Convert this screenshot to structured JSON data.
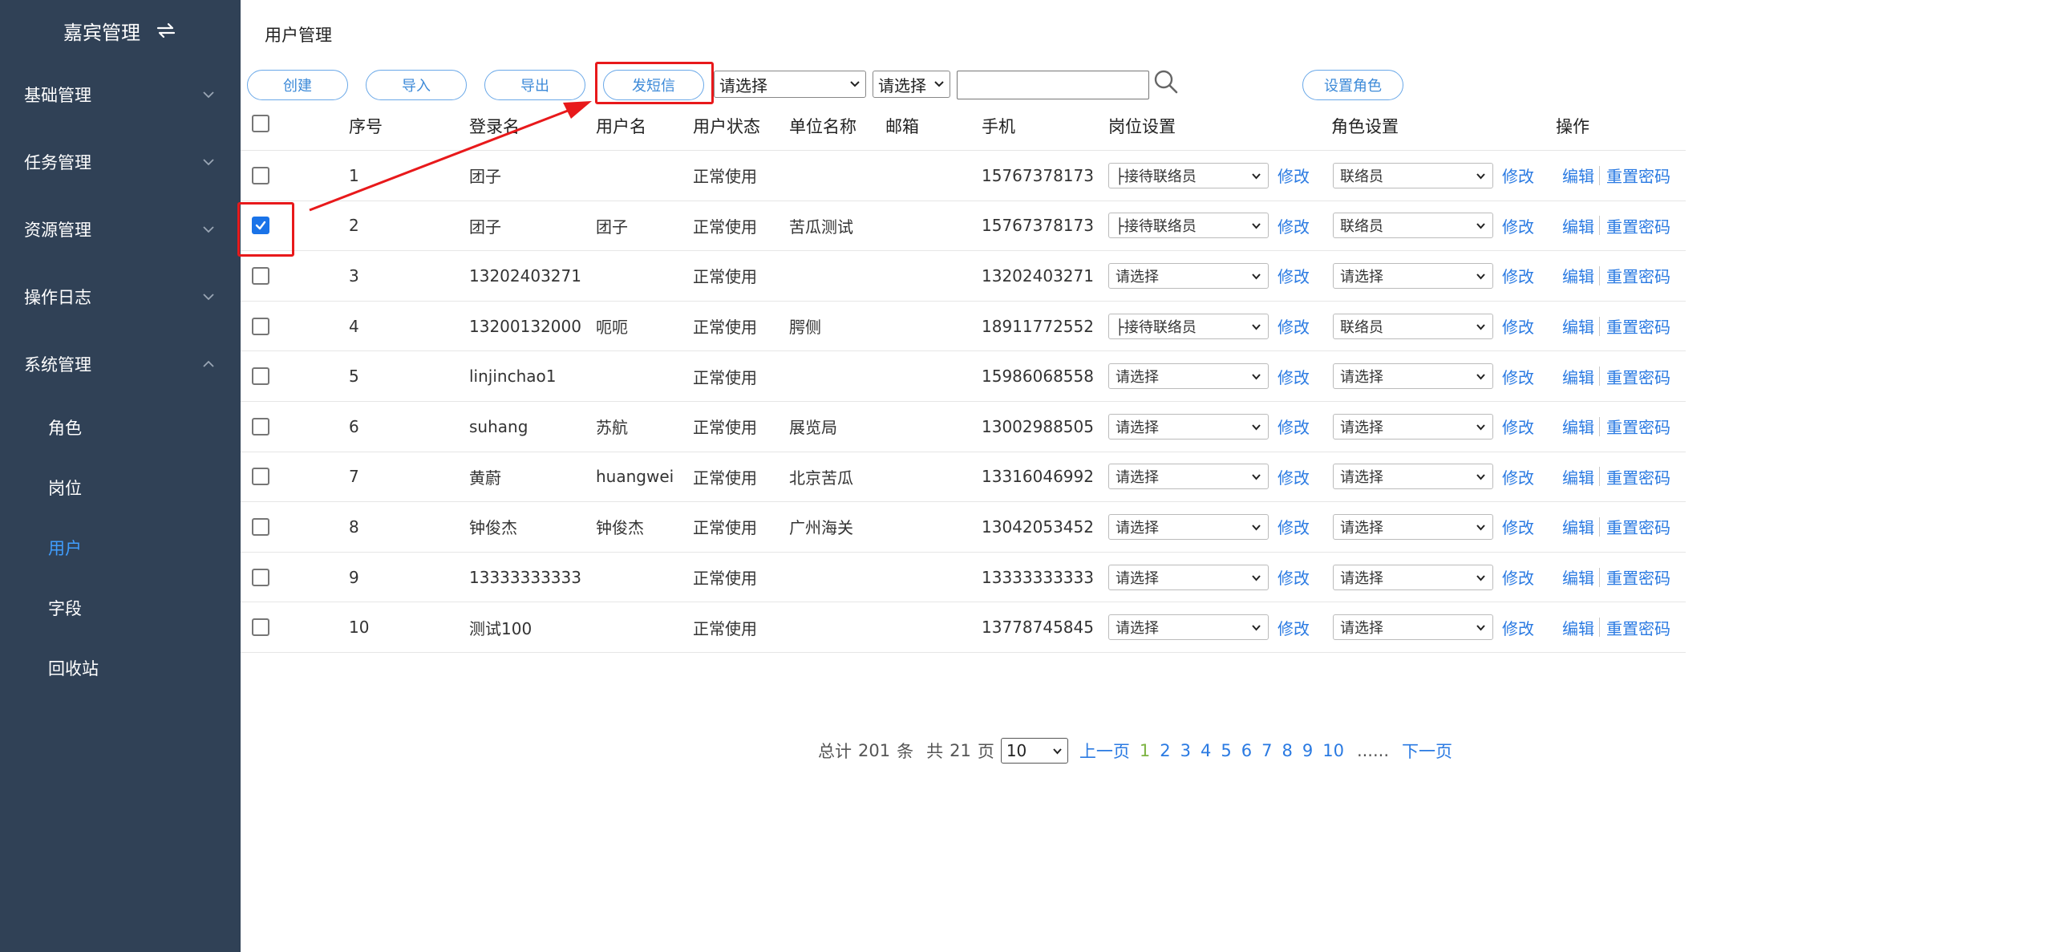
{
  "sidebar": {
    "title": "嘉宾管理",
    "menus": [
      {
        "label": "基础管理",
        "expanded": false
      },
      {
        "label": "任务管理",
        "expanded": false
      },
      {
        "label": "资源管理",
        "expanded": false
      },
      {
        "label": "操作日志",
        "expanded": false
      },
      {
        "label": "系统管理",
        "expanded": true
      }
    ],
    "sub_items": [
      {
        "label": "角色",
        "active": false
      },
      {
        "label": "岗位",
        "active": false
      },
      {
        "label": "用户",
        "active": true
      },
      {
        "label": "字段",
        "active": false
      },
      {
        "label": "回收站",
        "active": false
      }
    ]
  },
  "page": {
    "title": "用户管理"
  },
  "toolbar": {
    "create_label": "创建",
    "import_label": "导入",
    "export_label": "导出",
    "sms_label": "发短信",
    "filter1_value": "请选择",
    "filter2_value": "请选择",
    "search_value": "",
    "set_role_label": "设置角色"
  },
  "table": {
    "headers": {
      "index": "序号",
      "login": "登录名",
      "username": "用户名",
      "status": "用户状态",
      "unit": "单位名称",
      "email": "邮箱",
      "phone": "手机",
      "post": "岗位设置",
      "role": "角色设置",
      "ops": "操作"
    },
    "action_labels": {
      "modify": "修改",
      "edit": "编辑",
      "reset": "重置密码"
    },
    "rows": [
      {
        "index": "1",
        "login": "团子",
        "username": "",
        "status": "正常使用",
        "unit": "",
        "email": "",
        "phone": "15767378173",
        "post": "├接待联络员",
        "role": "联络员",
        "checked": false
      },
      {
        "index": "2",
        "login": "团子",
        "username": "团子",
        "status": "正常使用",
        "unit": "苦瓜测试",
        "email": "",
        "phone": "15767378173",
        "post": "├接待联络员",
        "role": "联络员",
        "checked": true
      },
      {
        "index": "3",
        "login": "13202403271",
        "username": "",
        "status": "正常使用",
        "unit": "",
        "email": "",
        "phone": "13202403271",
        "post": "请选择",
        "role": "请选择",
        "checked": false
      },
      {
        "index": "4",
        "login": "13200132000",
        "username": "呃呃",
        "status": "正常使用",
        "unit": "腭侧",
        "email": "",
        "phone": "18911772552",
        "post": "├接待联络员",
        "role": "联络员",
        "checked": false
      },
      {
        "index": "5",
        "login": "linjinchao1",
        "username": "",
        "status": "正常使用",
        "unit": "",
        "email": "",
        "phone": "15986068558",
        "post": "请选择",
        "role": "请选择",
        "checked": false
      },
      {
        "index": "6",
        "login": "suhang",
        "username": "苏航",
        "status": "正常使用",
        "unit": "展览局",
        "email": "",
        "phone": "13002988505",
        "post": "请选择",
        "role": "请选择",
        "checked": false
      },
      {
        "index": "7",
        "login": "黄蔚",
        "username": "huangwei",
        "status": "正常使用",
        "unit": "北京苦瓜",
        "email": "",
        "phone": "13316046992",
        "post": "请选择",
        "role": "请选择",
        "checked": false
      },
      {
        "index": "8",
        "login": "钟俊杰",
        "username": "钟俊杰",
        "status": "正常使用",
        "unit": "广州海关",
        "email": "",
        "phone": "13042053452",
        "post": "请选择",
        "role": "请选择",
        "checked": false
      },
      {
        "index": "9",
        "login": "13333333333",
        "username": "",
        "status": "正常使用",
        "unit": "",
        "email": "",
        "phone": "13333333333",
        "post": "请选择",
        "role": "请选择",
        "checked": false
      },
      {
        "index": "10",
        "login": "测试100",
        "username": "",
        "status": "正常使用",
        "unit": "",
        "email": "",
        "phone": "13778745845",
        "post": "请选择",
        "role": "请选择",
        "checked": false
      }
    ]
  },
  "pagination": {
    "total_prefix": "总计",
    "total": "201",
    "total_suffix": "条",
    "pages_prefix": "共",
    "pages": "21",
    "pages_suffix": "页",
    "page_size": "10",
    "prev": "上一页",
    "next": "下一页",
    "page_numbers": [
      "1",
      "2",
      "3",
      "4",
      "5",
      "6",
      "7",
      "8",
      "9",
      "10"
    ],
    "current": "1",
    "ellipsis": "......"
  },
  "colors": {
    "sidebar_bg": "#304156",
    "active_menu": "#409eff",
    "link": "#2a7ae2",
    "highlight": "#e8191b",
    "current_page": "#7cb342"
  }
}
